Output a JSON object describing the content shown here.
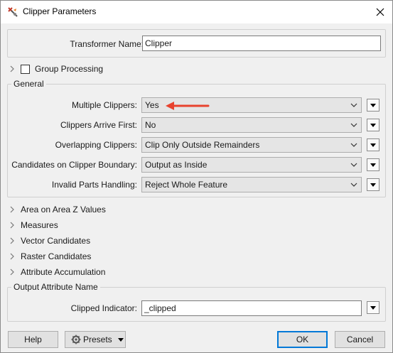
{
  "window": {
    "title": "Clipper Parameters",
    "title_icon": "fme-transformer-icon",
    "close_icon": "close-icon"
  },
  "transformer": {
    "name_label": "Transformer Name:",
    "name_value": "Clipper"
  },
  "group_processing": {
    "label": "Group Processing",
    "checked": false
  },
  "general": {
    "title": "General",
    "rows": [
      {
        "label": "Multiple Clippers:",
        "value": "Yes"
      },
      {
        "label": "Clippers Arrive First:",
        "value": "No"
      },
      {
        "label": "Overlapping Clippers:",
        "value": "Clip Only Outside Remainders"
      },
      {
        "label": "Candidates on Clipper Boundary:",
        "value": "Output as Inside"
      },
      {
        "label": "Invalid Parts Handling:",
        "value": "Reject Whole Feature"
      }
    ]
  },
  "collapsed_sections": [
    "Area on Area Z Values",
    "Measures",
    "Vector Candidates",
    "Raster Candidates",
    "Attribute Accumulation"
  ],
  "output": {
    "title": "Output Attribute Name",
    "label": "Clipped Indicator:",
    "value": "_clipped"
  },
  "footer": {
    "help": "Help",
    "presets": "Presets",
    "ok": "OK",
    "cancel": "Cancel"
  },
  "colors": {
    "annotation_arrow": "#e8432e",
    "ok_focus": "#0078d7"
  }
}
